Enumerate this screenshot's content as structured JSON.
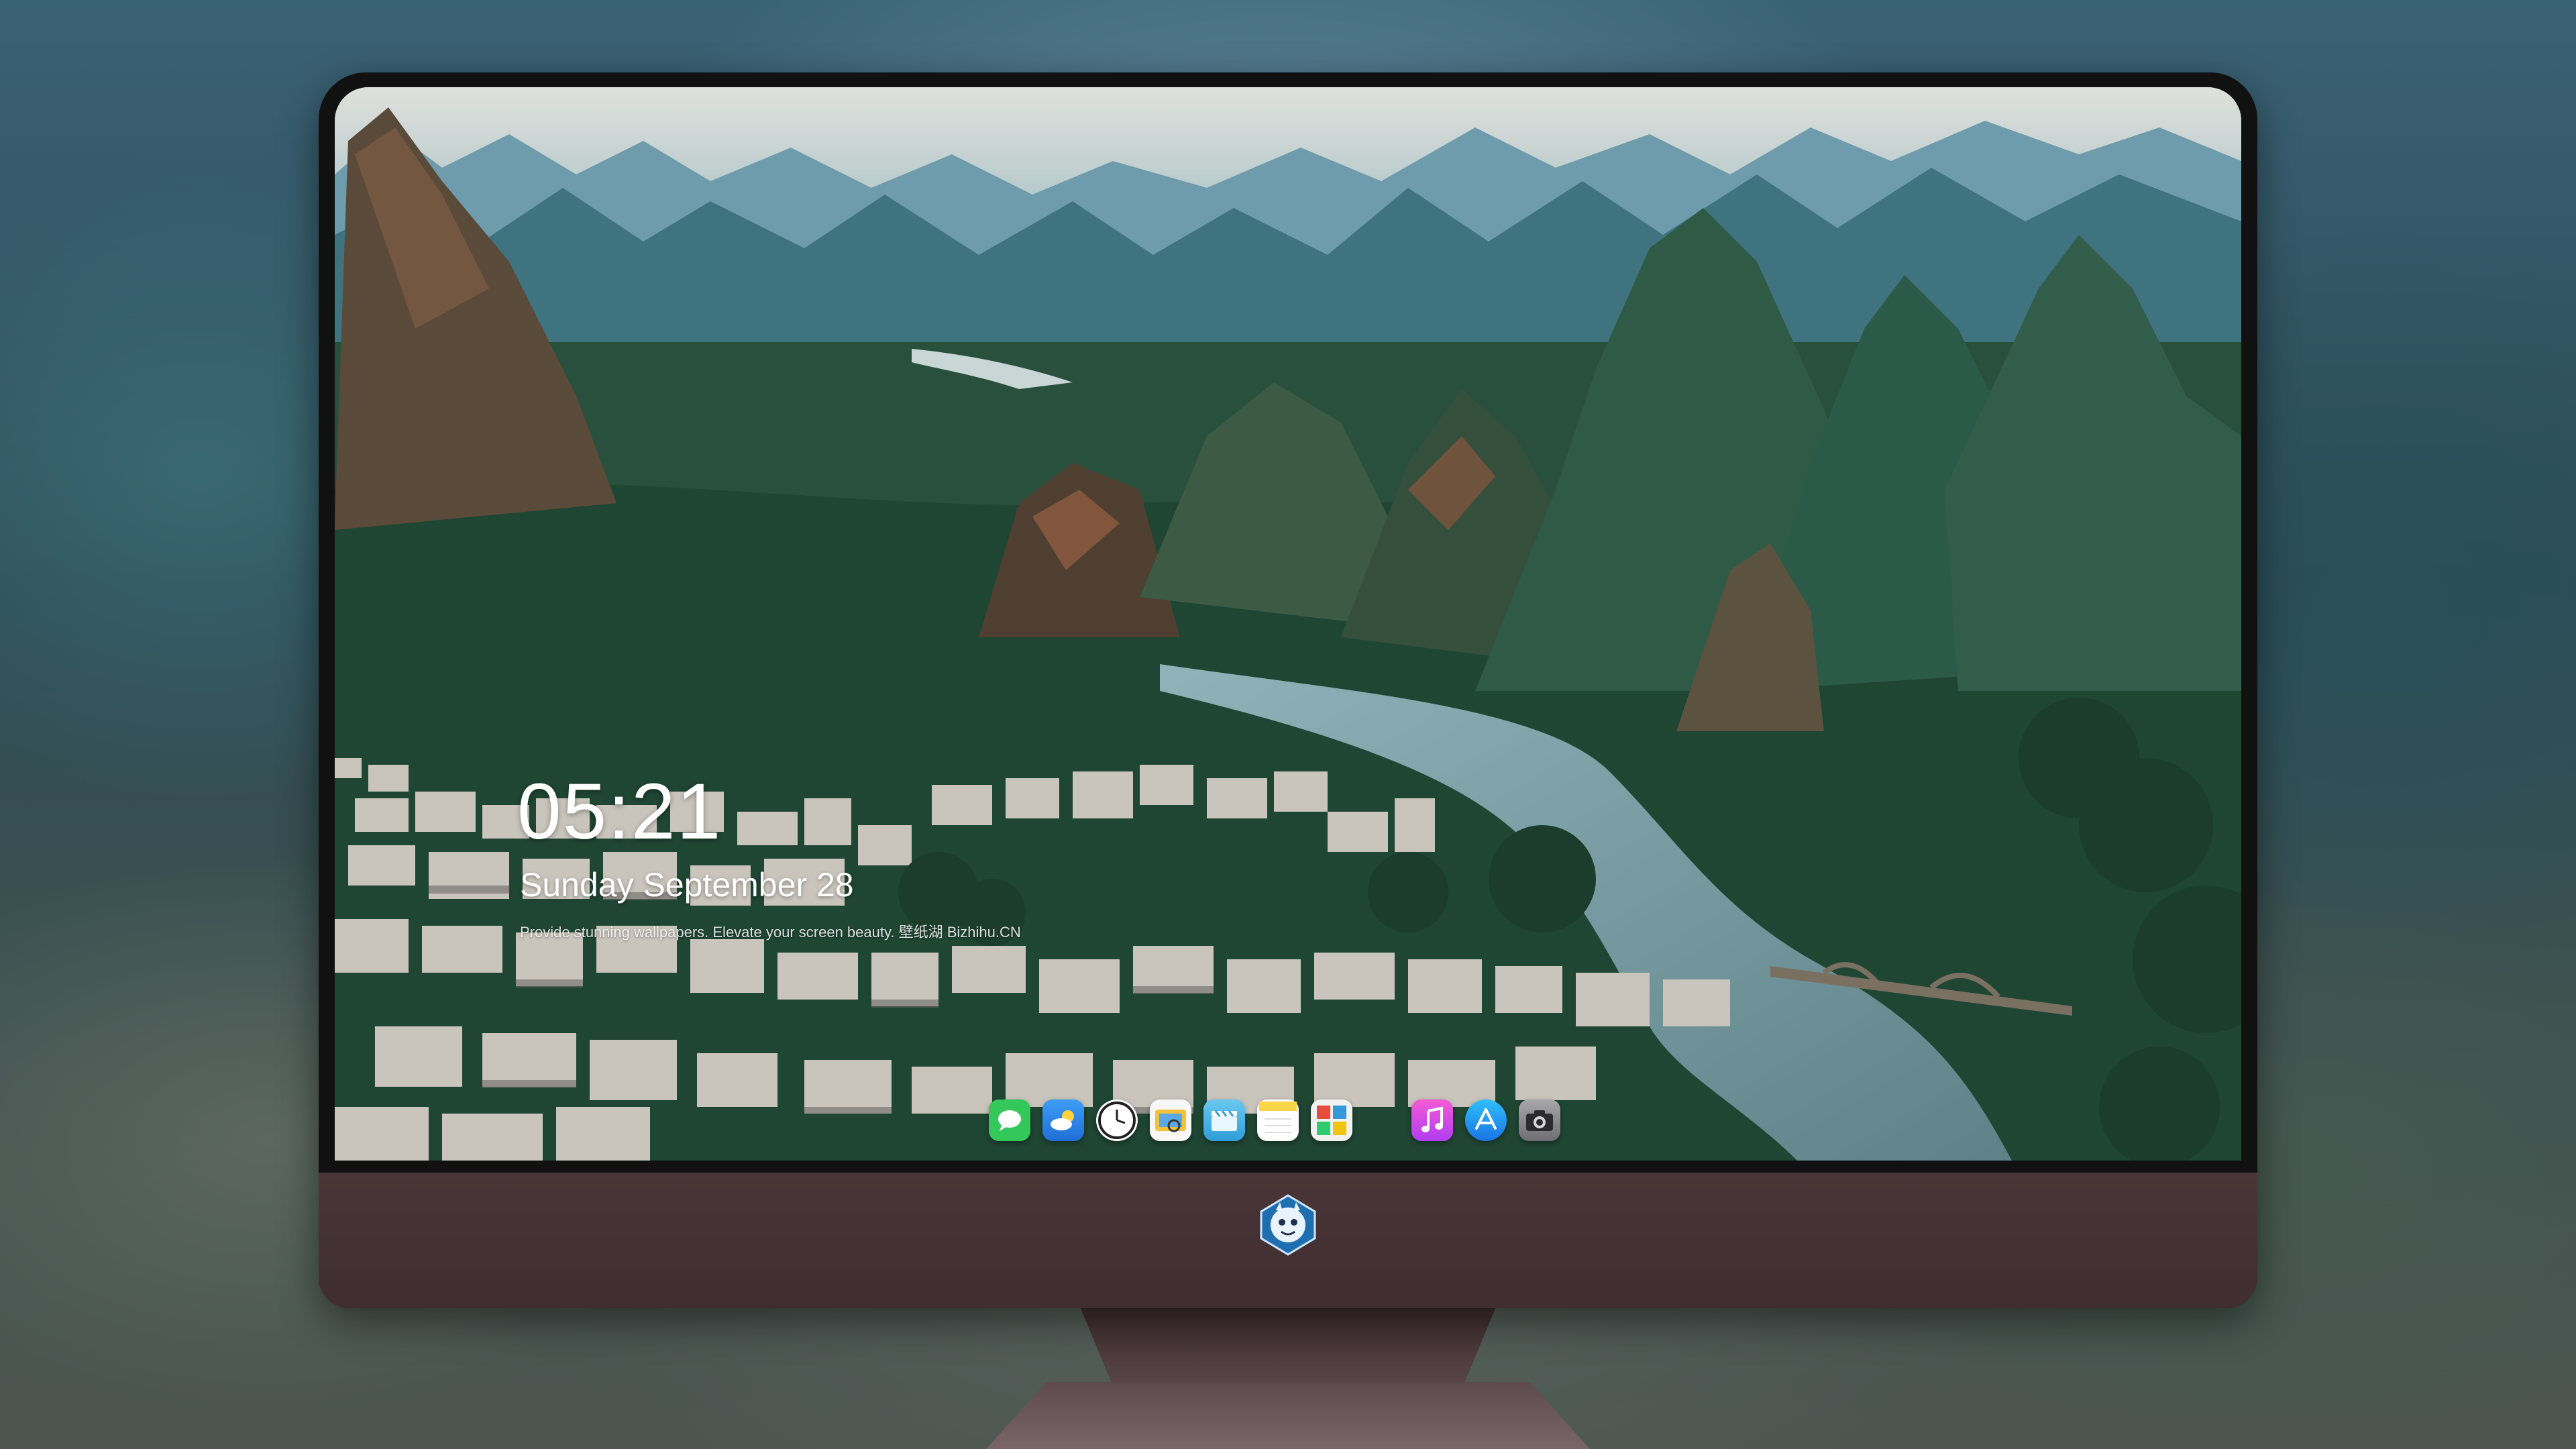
{
  "lock_screen": {
    "time": "05:21",
    "date": "Sunday September  28",
    "tagline": "Provide stunning wallpapers. Elevate your screen beauty. 壁纸湖 Bizhihu.CN"
  },
  "dock": {
    "items": [
      {
        "name": "messages",
        "icon": "messages-icon",
        "color": "#34c759"
      },
      {
        "name": "weather",
        "icon": "weather-icon",
        "color": "#2f8cf0"
      },
      {
        "name": "clock",
        "icon": "clock-icon",
        "color": "#ffffff"
      },
      {
        "name": "preview",
        "icon": "preview-icon",
        "color": "#f2c33a"
      },
      {
        "name": "clips",
        "icon": "clips-icon",
        "color": "#4fb8e8"
      },
      {
        "name": "notes",
        "icon": "notes-icon",
        "color": "#ffd54a"
      },
      {
        "name": "photo-booth",
        "icon": "photo-booth-icon",
        "color": "#e9e9e9"
      },
      {
        "name": "music",
        "icon": "music-icon",
        "color": "#e84bd6"
      },
      {
        "name": "app-store",
        "icon": "app-store-icon",
        "color": "#1c8ef0"
      },
      {
        "name": "camera",
        "icon": "camera-icon",
        "color": "#8e8e93"
      }
    ]
  },
  "monitor": {
    "logo": "dragon-mascot-logo"
  }
}
